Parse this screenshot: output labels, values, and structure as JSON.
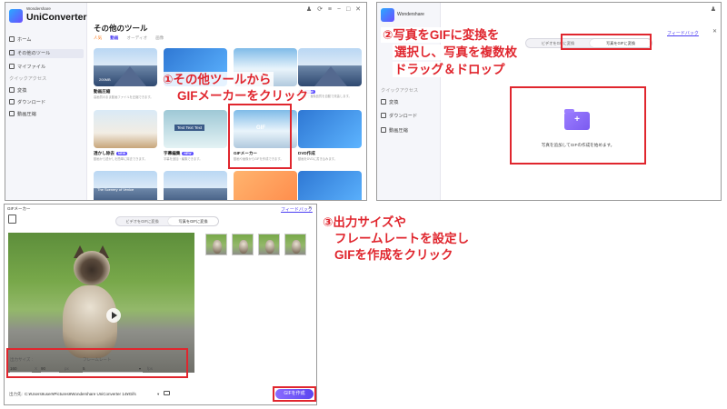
{
  "panel1": {
    "logo_small": "Wondershare",
    "logo_big": "UniConverter",
    "window_controls": "♟ ⟳ ≡ − □ ✕",
    "sidebar": [
      {
        "label": "ホーム"
      },
      {
        "label": "その他のツール"
      },
      {
        "label": "マイファイル"
      },
      {
        "label": "クイックアクセス"
      },
      {
        "label": "変換"
      },
      {
        "label": "ダウンロード"
      },
      {
        "label": "動画圧縮"
      }
    ],
    "page_title": "その他のツール",
    "tabs": [
      "人気",
      "動画",
      "オーディオ",
      "画像"
    ],
    "cards": [
      {
        "name": "動画圧縮",
        "desc": "高画質のまま動画ファイルを圧縮できます。"
      },
      {
        "name": "",
        "desc": ""
      },
      {
        "name": "",
        "desc": ""
      },
      {
        "name": "AI",
        "desc": "AI機能で画像品質を自動で改善します。"
      },
      {
        "name": "透かし除去",
        "desc": "動画から透かしを簡単に除去できます。"
      },
      {
        "name": "字幕編集",
        "desc": "字幕を追加・編集できます。"
      },
      {
        "name": "GIFメーカー",
        "desc": "動画や画像からGIFを作成できます。"
      },
      {
        "name": "DVD作成",
        "desc": "動画をDVDに書き込みます。"
      }
    ],
    "card_texts": [
      "200MB",
      "Text Text Text",
      "GIF",
      "The Scenery of Venice"
    ],
    "badge_new": "NEW",
    "annotation": "①その他ツールから\n　GIFメーカーをクリック"
  },
  "panel2": {
    "logo_small": "Wondershare",
    "win_icon": "♟",
    "sidebar": [
      {
        "label": "クイックアクセス"
      },
      {
        "label": "変換"
      },
      {
        "label": "ダウンロード"
      },
      {
        "label": "動画圧縮"
      }
    ],
    "toggle": {
      "left": "ビデオをGIFに変換",
      "right": "写真をGIFに変換"
    },
    "feedback": "フィードバック",
    "close": "✕",
    "drop_text": "写真を追加してGIFの作成を始めます。",
    "plus": "+",
    "annotation": "②写真をGIFに変換を\n　選択し、写真を複数枚\n　ドラッグ＆ドロップ"
  },
  "panel3": {
    "title": "GIFメーカー",
    "feedback": "フィードバック",
    "close": "✕",
    "toggle": {
      "left": "ビデオをGIFに変換",
      "right": "写真をGIFに変換"
    },
    "output_size_label": "出力サイズ :",
    "frame_rate_label": "フレームレート",
    "width": "160",
    "x": "X",
    "height": "90",
    "px": "px",
    "fps_value": "5",
    "fps_unit": "fps",
    "output_path_label": "出力先:",
    "output_path": "C:¥Users¥user¥Pictures¥Wondershare UniConverter 14¥Gifs",
    "create_button": "GIFを作成",
    "annotation": "③出力サイズや\n　フレームレートを設定し\n　GIFを作成をクリック"
  },
  "colors": {
    "red": "#e0262e",
    "purple": "#5a46f0"
  }
}
